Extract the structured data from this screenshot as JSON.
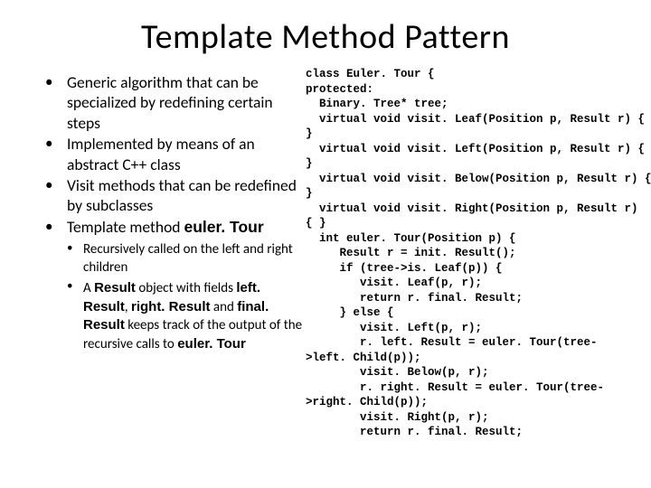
{
  "title": "Template Method Pattern",
  "bullets": {
    "b1": "Generic algorithm that can be specialized by redefining certain steps",
    "b2": "Implemented by means of an abstract C++ class",
    "b3": "Visit methods that can be redefined by subclasses",
    "b4_pre": "Template method ",
    "b4_code": "euler. Tour",
    "s1": "Recursively called on the left and right children",
    "s2_a": "A ",
    "s2_res": "Result",
    "s2_b": " object with fields ",
    "s2_left": "left. Result",
    "s2_c": ", ",
    "s2_right": "right. Result",
    "s2_d": " and ",
    "s2_final": "final. Result",
    "s2_e": " keeps track of the output of the recursive calls to ",
    "s2_et": "euler. Tour"
  },
  "code": {
    "l01": "class Euler. Tour {",
    "l02": "protected:",
    "l03": "  Binary. Tree* tree;",
    "l04": "  virtual void visit. Leaf(Position p, Result r) {",
    "l05": "}",
    "l06": "  virtual void visit. Left(Position p, Result r) {",
    "l07": "}",
    "l08": "  virtual void visit. Below(Position p, Result r) {",
    "l09": "}",
    "l10": "  virtual void visit. Right(Position p, Result r)",
    "l11": "{ }",
    "l12": "  int euler. Tour(Position p) {",
    "l13": "     Result r = init. Result();",
    "l14": "     if (tree->is. Leaf(p)) {",
    "l15": "        visit. Leaf(p, r);",
    "l16": "        return r. final. Result;",
    "l17": "     } else {",
    "l18": "        visit. Left(p, r);",
    "l19": "        r. left. Result = euler. Tour(tree-",
    "l20": ">left. Child(p));",
    "l21": "        visit. Below(p, r);",
    "l22": "        r. right. Result = euler. Tour(tree-",
    "l23": ">right. Child(p));",
    "l24": "        visit. Right(p, r);",
    "l25": "        return r. final. Result;"
  }
}
